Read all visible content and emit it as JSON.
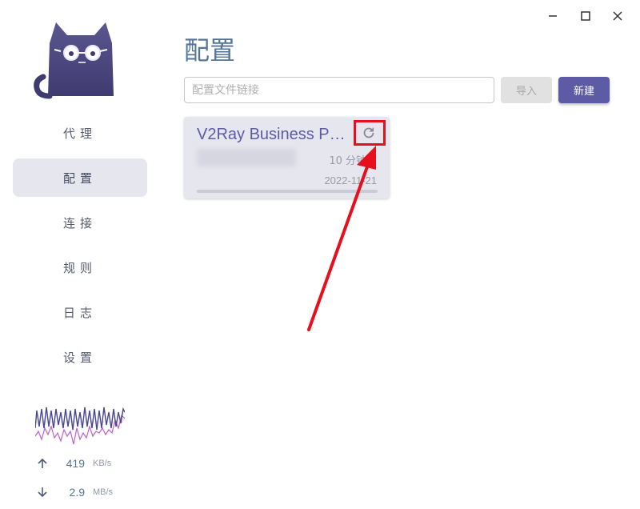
{
  "window": {
    "controls": [
      "minimize-icon",
      "maximize-icon",
      "close-icon"
    ]
  },
  "sidebar": {
    "logo_icon": "cat-logo",
    "nav_items": [
      {
        "label": "代理",
        "active": false
      },
      {
        "label": "配置",
        "active": true
      },
      {
        "label": "连接",
        "active": false
      },
      {
        "label": "规则",
        "active": false
      },
      {
        "label": "日志",
        "active": false
      },
      {
        "label": "设置",
        "active": false
      }
    ],
    "traffic": {
      "upload_value": "419",
      "upload_unit": "KB/s",
      "download_value": "2.9",
      "download_unit": "MB/s"
    }
  },
  "main": {
    "title": "配置",
    "url_input": {
      "value": "",
      "placeholder": "配置文件链接"
    },
    "import_label": "导入",
    "new_label": "新建",
    "profiles": [
      {
        "name": "V2Ray Business P…",
        "updated": "10 分钟前",
        "date": "2022-11-21",
        "refresh_icon": "refresh-icon"
      }
    ]
  },
  "colors": {
    "accent": "#5d5aa6",
    "title": "#54759a",
    "active_nav_bg": "#e6e6ef",
    "annotation": "#e5101c"
  }
}
